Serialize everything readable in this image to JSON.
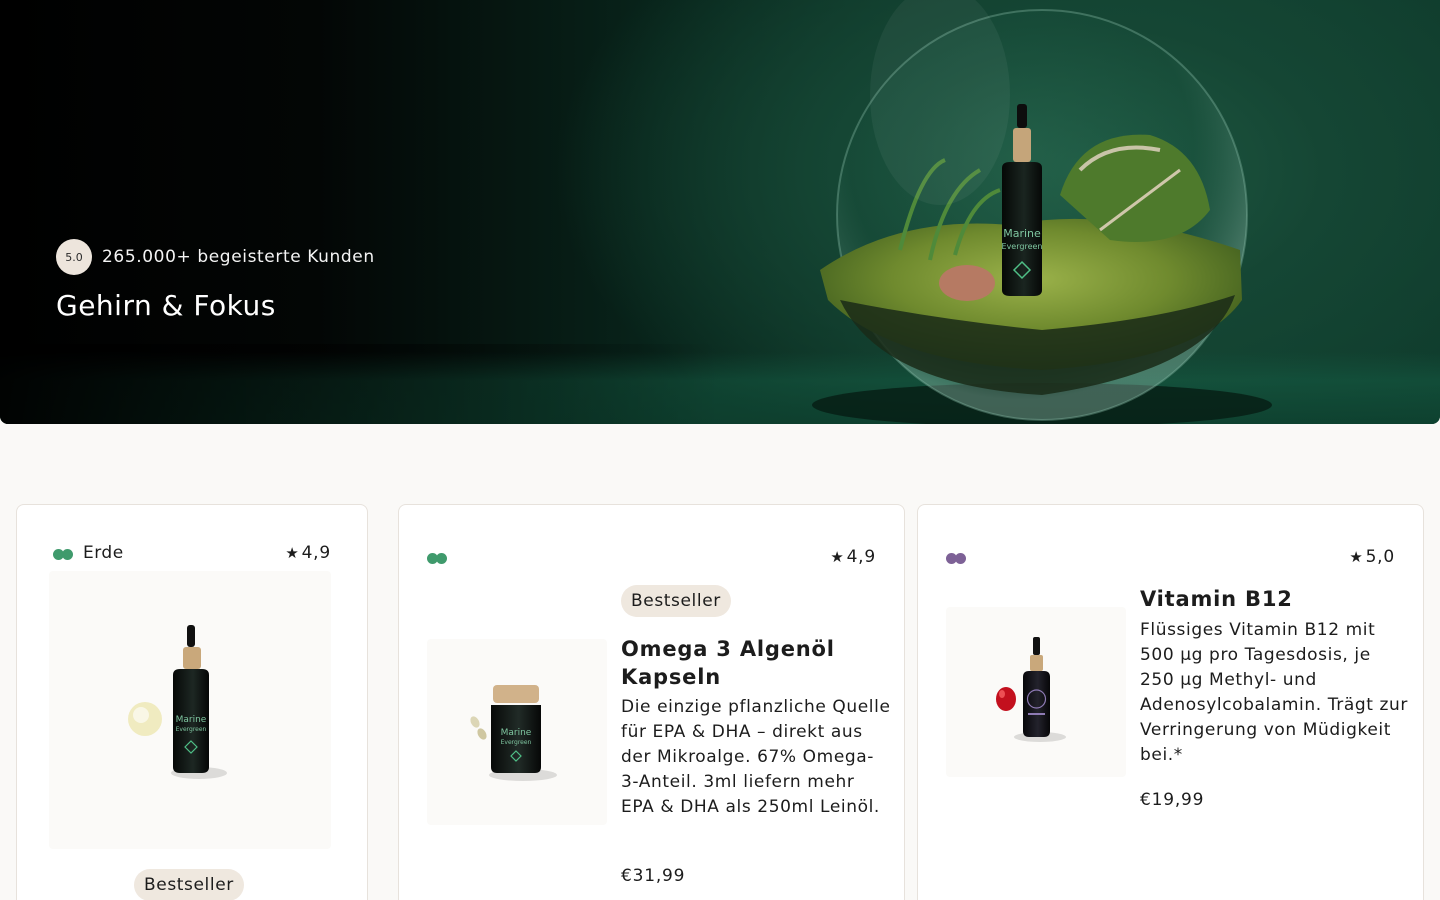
{
  "hero": {
    "rating_badge": "5.0",
    "customers_text": "265.000+ begeisterte Kunden",
    "title": "Gehirn & Fokus",
    "image_icon": "terrarium-bottle-image"
  },
  "products": [
    {
      "category": "Erde",
      "rating": "4,9",
      "badge": "Bestseller",
      "dot_colors": [
        "#3f9a6c",
        "#3f9a6c"
      ],
      "image_icon": "dropper-bottle-image"
    },
    {
      "category": "",
      "rating": "4,9",
      "badge": "Bestseller",
      "title": "Omega 3 Algenöl Kapseln",
      "description": "Die einzige pflanzliche Quelle für EPA & DHA – direkt aus der Mikroalge. 67% Omega-3-Anteil. 3ml liefern mehr EPA & DHA als 250ml Leinöl.",
      "price": "€31,99",
      "dot_colors": [
        "#3f9a6c",
        "#3f9a6c"
      ],
      "image_icon": "capsule-jar-image"
    },
    {
      "category": "",
      "rating": "5,0",
      "title": "Vitamin B12",
      "description": "Flüssiges Vitamin B12 mit 500 µg pro Tagesdosis, je 250 µg Methyl- und Adenosylcobalamin. Trägt zur Verringerung von Müdigkeit bei.*",
      "price": "€19,99",
      "dot_colors": [
        "#7d6196",
        "#7d6196"
      ],
      "image_icon": "b12-bottle-image"
    }
  ],
  "star_glyph": "★"
}
